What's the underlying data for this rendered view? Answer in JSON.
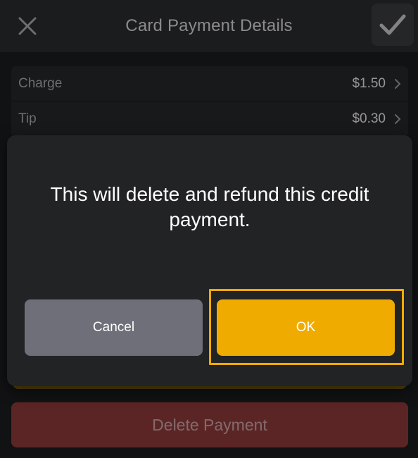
{
  "header": {
    "title": "Card Payment Details",
    "close_icon": "close-icon",
    "confirm_icon": "checkmark-icon"
  },
  "payment_rows": [
    {
      "label": "Charge",
      "value": "$1.50"
    },
    {
      "label": "Tip",
      "value": "$0.30"
    }
  ],
  "delete_button_label": "Delete Payment",
  "dialog": {
    "message": "This will delete and refund this credit payment.",
    "cancel_label": "Cancel",
    "ok_label": "OK"
  },
  "colors": {
    "accent": "#f0ab00",
    "danger": "#8c3a3b",
    "cancel": "#6e6f78"
  }
}
